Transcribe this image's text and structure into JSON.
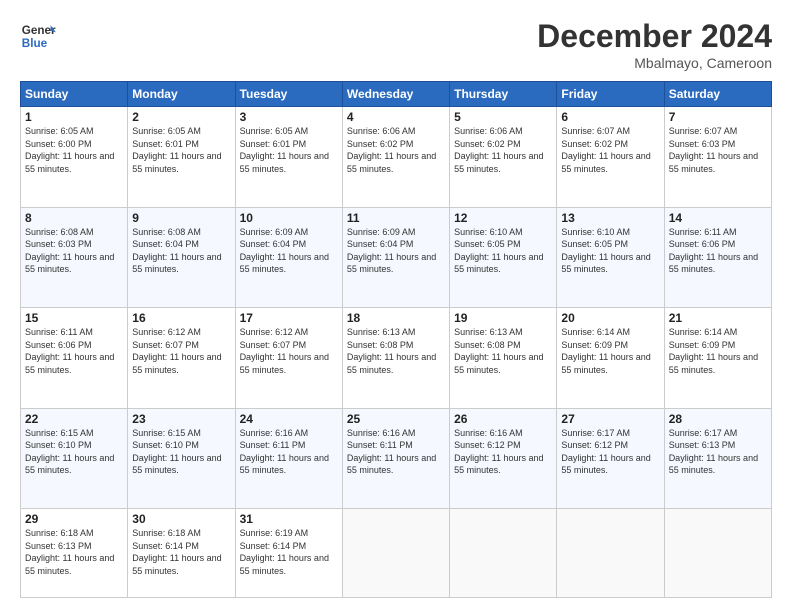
{
  "header": {
    "logo_text_general": "General",
    "logo_text_blue": "Blue",
    "month_year": "December 2024",
    "location": "Mbalmayo, Cameroon"
  },
  "days_of_week": [
    "Sunday",
    "Monday",
    "Tuesday",
    "Wednesday",
    "Thursday",
    "Friday",
    "Saturday"
  ],
  "weeks": [
    [
      {
        "day": 1,
        "sunrise": "6:05 AM",
        "sunset": "6:00 PM",
        "daylight": "11 hours and 55 minutes."
      },
      {
        "day": 2,
        "sunrise": "6:05 AM",
        "sunset": "6:01 PM",
        "daylight": "11 hours and 55 minutes."
      },
      {
        "day": 3,
        "sunrise": "6:05 AM",
        "sunset": "6:01 PM",
        "daylight": "11 hours and 55 minutes."
      },
      {
        "day": 4,
        "sunrise": "6:06 AM",
        "sunset": "6:02 PM",
        "daylight": "11 hours and 55 minutes."
      },
      {
        "day": 5,
        "sunrise": "6:06 AM",
        "sunset": "6:02 PM",
        "daylight": "11 hours and 55 minutes."
      },
      {
        "day": 6,
        "sunrise": "6:07 AM",
        "sunset": "6:02 PM",
        "daylight": "11 hours and 55 minutes."
      },
      {
        "day": 7,
        "sunrise": "6:07 AM",
        "sunset": "6:03 PM",
        "daylight": "11 hours and 55 minutes."
      }
    ],
    [
      {
        "day": 8,
        "sunrise": "6:08 AM",
        "sunset": "6:03 PM",
        "daylight": "11 hours and 55 minutes."
      },
      {
        "day": 9,
        "sunrise": "6:08 AM",
        "sunset": "6:04 PM",
        "daylight": "11 hours and 55 minutes."
      },
      {
        "day": 10,
        "sunrise": "6:09 AM",
        "sunset": "6:04 PM",
        "daylight": "11 hours and 55 minutes."
      },
      {
        "day": 11,
        "sunrise": "6:09 AM",
        "sunset": "6:04 PM",
        "daylight": "11 hours and 55 minutes."
      },
      {
        "day": 12,
        "sunrise": "6:10 AM",
        "sunset": "6:05 PM",
        "daylight": "11 hours and 55 minutes."
      },
      {
        "day": 13,
        "sunrise": "6:10 AM",
        "sunset": "6:05 PM",
        "daylight": "11 hours and 55 minutes."
      },
      {
        "day": 14,
        "sunrise": "6:11 AM",
        "sunset": "6:06 PM",
        "daylight": "11 hours and 55 minutes."
      }
    ],
    [
      {
        "day": 15,
        "sunrise": "6:11 AM",
        "sunset": "6:06 PM",
        "daylight": "11 hours and 55 minutes."
      },
      {
        "day": 16,
        "sunrise": "6:12 AM",
        "sunset": "6:07 PM",
        "daylight": "11 hours and 55 minutes."
      },
      {
        "day": 17,
        "sunrise": "6:12 AM",
        "sunset": "6:07 PM",
        "daylight": "11 hours and 55 minutes."
      },
      {
        "day": 18,
        "sunrise": "6:13 AM",
        "sunset": "6:08 PM",
        "daylight": "11 hours and 55 minutes."
      },
      {
        "day": 19,
        "sunrise": "6:13 AM",
        "sunset": "6:08 PM",
        "daylight": "11 hours and 55 minutes."
      },
      {
        "day": 20,
        "sunrise": "6:14 AM",
        "sunset": "6:09 PM",
        "daylight": "11 hours and 55 minutes."
      },
      {
        "day": 21,
        "sunrise": "6:14 AM",
        "sunset": "6:09 PM",
        "daylight": "11 hours and 55 minutes."
      }
    ],
    [
      {
        "day": 22,
        "sunrise": "6:15 AM",
        "sunset": "6:10 PM",
        "daylight": "11 hours and 55 minutes."
      },
      {
        "day": 23,
        "sunrise": "6:15 AM",
        "sunset": "6:10 PM",
        "daylight": "11 hours and 55 minutes."
      },
      {
        "day": 24,
        "sunrise": "6:16 AM",
        "sunset": "6:11 PM",
        "daylight": "11 hours and 55 minutes."
      },
      {
        "day": 25,
        "sunrise": "6:16 AM",
        "sunset": "6:11 PM",
        "daylight": "11 hours and 55 minutes."
      },
      {
        "day": 26,
        "sunrise": "6:16 AM",
        "sunset": "6:12 PM",
        "daylight": "11 hours and 55 minutes."
      },
      {
        "day": 27,
        "sunrise": "6:17 AM",
        "sunset": "6:12 PM",
        "daylight": "11 hours and 55 minutes."
      },
      {
        "day": 28,
        "sunrise": "6:17 AM",
        "sunset": "6:13 PM",
        "daylight": "11 hours and 55 minutes."
      }
    ],
    [
      {
        "day": 29,
        "sunrise": "6:18 AM",
        "sunset": "6:13 PM",
        "daylight": "11 hours and 55 minutes."
      },
      {
        "day": 30,
        "sunrise": "6:18 AM",
        "sunset": "6:14 PM",
        "daylight": "11 hours and 55 minutes."
      },
      {
        "day": 31,
        "sunrise": "6:19 AM",
        "sunset": "6:14 PM",
        "daylight": "11 hours and 55 minutes."
      },
      null,
      null,
      null,
      null
    ]
  ]
}
